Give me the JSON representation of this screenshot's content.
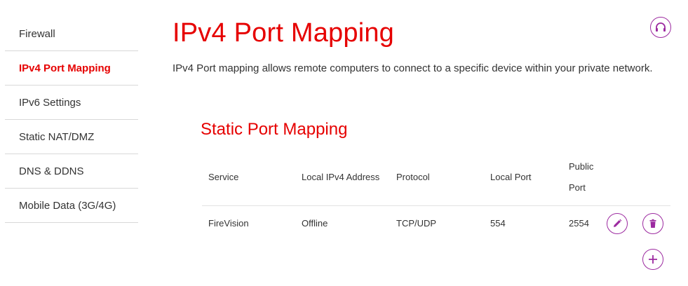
{
  "sidebar": {
    "items": [
      {
        "label": "Firewall"
      },
      {
        "label": "IPv4 Port Mapping"
      },
      {
        "label": "IPv6 Settings"
      },
      {
        "label": "Static NAT/DMZ"
      },
      {
        "label": "DNS & DDNS"
      },
      {
        "label": "Mobile Data (3G/4G)"
      }
    ]
  },
  "main": {
    "title": "IPv4 Port Mapping",
    "description": "IPv4 Port mapping allows remote computers to connect to a specific device within your private network.",
    "section_title": "Static Port Mapping",
    "table": {
      "headers": {
        "service": "Service",
        "local_ipv4": "Local IPv4 Address",
        "protocol": "Protocol",
        "local_port": "Local Port",
        "public_port_line1": "Public",
        "public_port_line2": "Port"
      },
      "rows": [
        {
          "service": "FireVision",
          "local_ipv4": "Offline",
          "protocol": "TCP/UDP",
          "local_port": "554",
          "public_port": "2554"
        }
      ]
    }
  },
  "colors": {
    "accent_red": "#e60000",
    "action_purple": "#9c2aa0"
  },
  "icons": {
    "help": "headset-icon",
    "edit": "pencil-icon",
    "delete": "trash-icon",
    "add": "plus-icon"
  }
}
